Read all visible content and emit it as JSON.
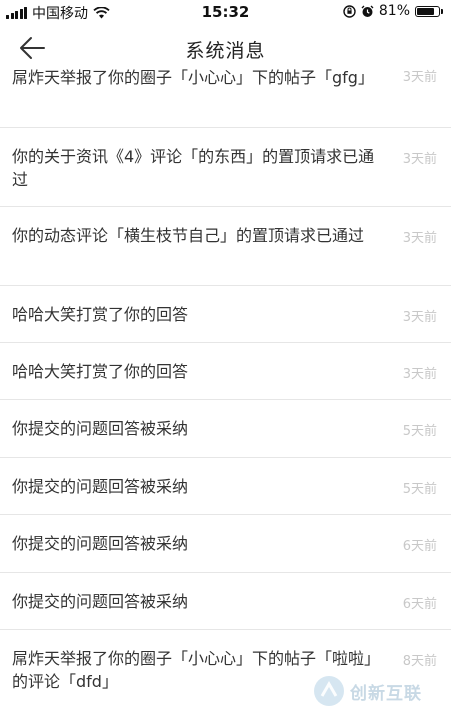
{
  "status_bar": {
    "carrier": "中国移动",
    "time": "15:32",
    "battery_pct_text": "81%",
    "battery_level": 0.81,
    "icons": [
      "signal-icon",
      "wifi-icon",
      "orientation-lock-icon",
      "alarm-icon",
      "battery-icon"
    ]
  },
  "nav": {
    "title": "系统消息",
    "back_icon": "arrow-left-icon"
  },
  "messages": [
    {
      "text": "屌炸天举报了你的圈子「小心心」下的帖子「gfg」",
      "time": "3天前"
    },
    {
      "text": "你的关于资讯《4》评论「的东西」的置顶请求已通过",
      "time": "3天前"
    },
    {
      "text": "你的动态评论「横生枝节自己」的置顶请求已通过",
      "time": "3天前"
    },
    {
      "text": "哈哈大笑打赏了你的回答",
      "time": "3天前"
    },
    {
      "text": "哈哈大笑打赏了你的回答",
      "time": "3天前"
    },
    {
      "text": "你提交的问题回答被采纳",
      "time": "5天前"
    },
    {
      "text": "你提交的问题回答被采纳",
      "time": "5天前"
    },
    {
      "text": "你提交的问题回答被采纳",
      "time": "6天前"
    },
    {
      "text": "你提交的问题回答被采纳",
      "time": "6天前"
    },
    {
      "text": "屌炸天举报了你的圈子「小心心」下的帖子「啦啦」的评论「dfd」",
      "time": "8天前"
    }
  ],
  "watermark": {
    "text": "创新互联"
  },
  "colors": {
    "text": "#333333",
    "time": "#c8c8c8",
    "divider": "#e6e6e6"
  }
}
